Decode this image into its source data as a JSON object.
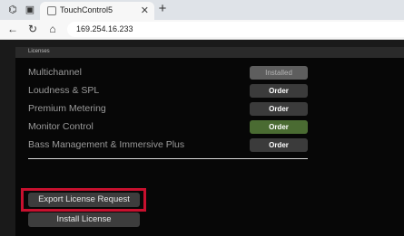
{
  "browser": {
    "tab_title": "TouchControl5",
    "url": "169.254.16.233",
    "close_glyph": "✕",
    "new_tab_glyph": "+"
  },
  "panel": {
    "title": "Licenses",
    "licenses": [
      {
        "name": "Multichannel",
        "action": "Installed",
        "state": "installed"
      },
      {
        "name": "Loudness & SPL",
        "action": "Order",
        "state": "order"
      },
      {
        "name": "Premium Metering",
        "action": "Order",
        "state": "order"
      },
      {
        "name": "Monitor Control",
        "action": "Order",
        "state": "highlighted"
      },
      {
        "name": "Bass Management & Immersive Plus",
        "action": "Order",
        "state": "order"
      }
    ],
    "export_label": "Export License Request",
    "install_label": "Install License"
  },
  "colors": {
    "highlight_border": "#c8102e",
    "order_green": "#4a6b32"
  }
}
